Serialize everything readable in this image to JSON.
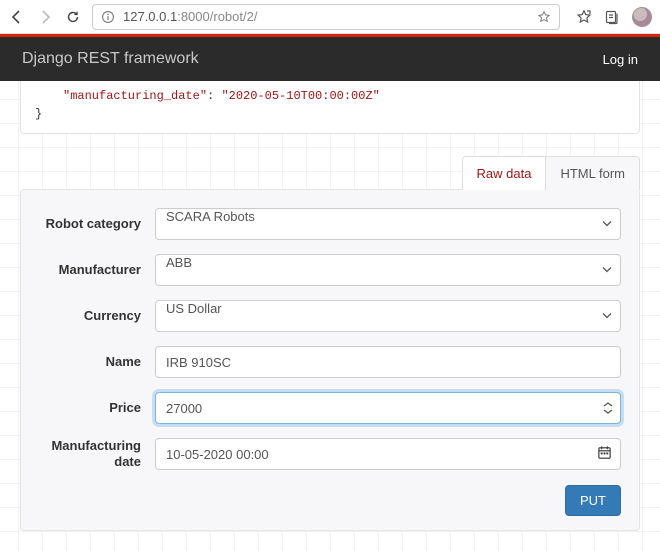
{
  "browser": {
    "url_host": "127.0.0.1",
    "url_path": ":8000/robot/2/"
  },
  "header": {
    "title": "Django REST framework",
    "login": "Log in"
  },
  "json_snippet": {
    "key": "\"manufacturing_date\"",
    "value": "\"2020-05-10T00:00:00Z\""
  },
  "tabs": {
    "raw": "Raw data",
    "html": "HTML form"
  },
  "form": {
    "robot_category": {
      "label": "Robot category",
      "value": "SCARA Robots"
    },
    "manufacturer": {
      "label": "Manufacturer",
      "value": "ABB"
    },
    "currency": {
      "label": "Currency",
      "value": "US Dollar"
    },
    "name": {
      "label": "Name",
      "value": "IRB 910SC"
    },
    "price": {
      "label": "Price",
      "value": "27000"
    },
    "manufacturing_date": {
      "label": "Manufacturing date",
      "value": "10-05-2020 00:00"
    },
    "submit": "PUT"
  }
}
